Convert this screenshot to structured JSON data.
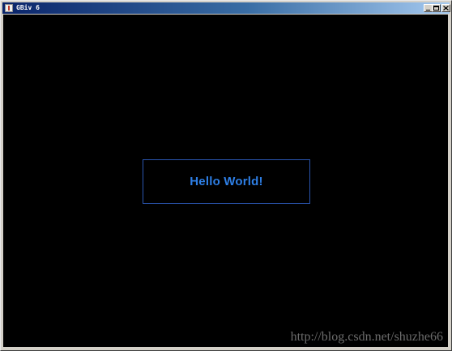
{
  "window": {
    "title": "GBiv 6",
    "minimize_label": "_",
    "maximize_label": "□",
    "close_label": "×"
  },
  "canvas": {
    "background": "#000000",
    "message": "Hello World!",
    "message_color": "#2e7fe6",
    "box_border_color": "#2a55b0"
  },
  "watermark": "http://blog.csdn.net/shuzhe66",
  "colors": {
    "titlebar_start": "#0a246a",
    "titlebar_end": "#a6caf0",
    "window_chrome": "#d4d0c8"
  }
}
